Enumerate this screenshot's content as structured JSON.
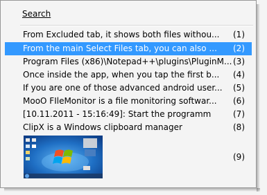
{
  "menu": {
    "search_label": "Search",
    "items": [
      {
        "text": "From Excluded tab, it shows both files withou...",
        "num": "(1)",
        "selected": false
      },
      {
        "text": "From the main Select Files tab, you can also ...",
        "num": "(2)",
        "selected": true
      },
      {
        "text": "Program Files (x86)\\Notepad++\\plugins\\PluginM...",
        "num": "(3)",
        "selected": false
      },
      {
        "text": "Once inside the app, when you tap the first b...",
        "num": "(4)",
        "selected": false
      },
      {
        "text": "If you are one of those advanced android user...",
        "num": "(5)",
        "selected": false
      },
      {
        "text": "MooO FIleMonitor is a file monitoring softwar...",
        "num": "(6)",
        "selected": false
      },
      {
        "text": "[10.11.2011 - 15:16:49]: Start the programm",
        "num": "(7)",
        "selected": false
      },
      {
        "text": "ClipX is a Windows clipboard manager",
        "num": "(8)",
        "selected": false
      }
    ],
    "image_item": {
      "num": "(9)",
      "image": "windows-7-desktop-thumbnail"
    }
  },
  "colors": {
    "background": "#f4f4f4",
    "highlight": "#3399ff",
    "highlight_text": "#ffffff"
  }
}
